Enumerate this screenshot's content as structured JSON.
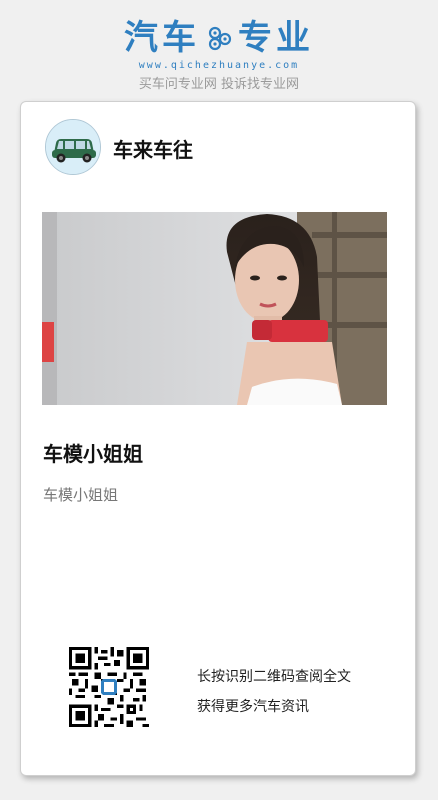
{
  "brand": {
    "logo_left": "汽车",
    "logo_right": "专业",
    "url": "www.qichezhuanye.com",
    "tagline": "买车问专业网 投诉找专业网"
  },
  "article": {
    "author": "车来车往",
    "title": "车模小姐姐",
    "subtitle": "车模小姐姐"
  },
  "qr": {
    "line1": "长按识别二维码查阅全文",
    "line2": "获得更多汽车资讯"
  },
  "colors": {
    "brand_blue": "#2f7fc0",
    "card_bg": "#ffffff",
    "page_bg": "#f0f0f0"
  }
}
